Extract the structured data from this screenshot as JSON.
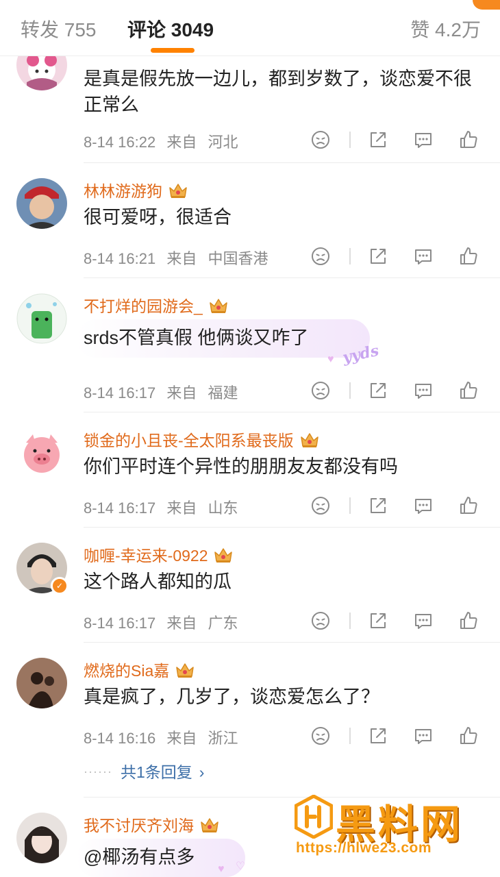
{
  "tabs": {
    "forward": "转发 755",
    "comments": "评论 3049",
    "likes": "赞 4.2万"
  },
  "comments": [
    {
      "text": "是真是假先放一边儿，都到岁数了，谈恋爱不很正常么",
      "time": "8-14 16:22",
      "from": "来自",
      "location": "河北"
    },
    {
      "user": "林林游游狗",
      "text": "很可爱呀，很适合",
      "time": "8-14 16:21",
      "from": "来自",
      "location": "中国香港"
    },
    {
      "user": "不打烊的园游会_",
      "text": "srds不管真假 他俩谈又咋了",
      "sticker": "yyds",
      "time": "8-14 16:17",
      "from": "来自",
      "location": "福建"
    },
    {
      "user": "锁金的小且丧-全太阳系最丧版",
      "text": "你们平时连个异性的朋朋友友都没有吗",
      "time": "8-14 16:17",
      "from": "来自",
      "location": "山东"
    },
    {
      "user": "咖喱-幸运来-0922",
      "text": "这个路人都知的瓜",
      "time": "8-14 16:17",
      "from": "来自",
      "location": "广东"
    },
    {
      "user": "燃烧的Sia嘉",
      "text": "真是疯了，几岁了，谈恋爱怎么了？",
      "time": "8-14 16:16",
      "from": "来自",
      "location": "浙江",
      "replies": "共1条回复"
    },
    {
      "user": "我不讨厌齐刘海",
      "text": "@椰汤有点多"
    }
  ],
  "watermark": {
    "title": "黑料网",
    "url": "https://hlwe23.com"
  },
  "colors": {
    "accent": "#ff8200",
    "username": "#e06a1b",
    "link": "#3d6fa8"
  }
}
